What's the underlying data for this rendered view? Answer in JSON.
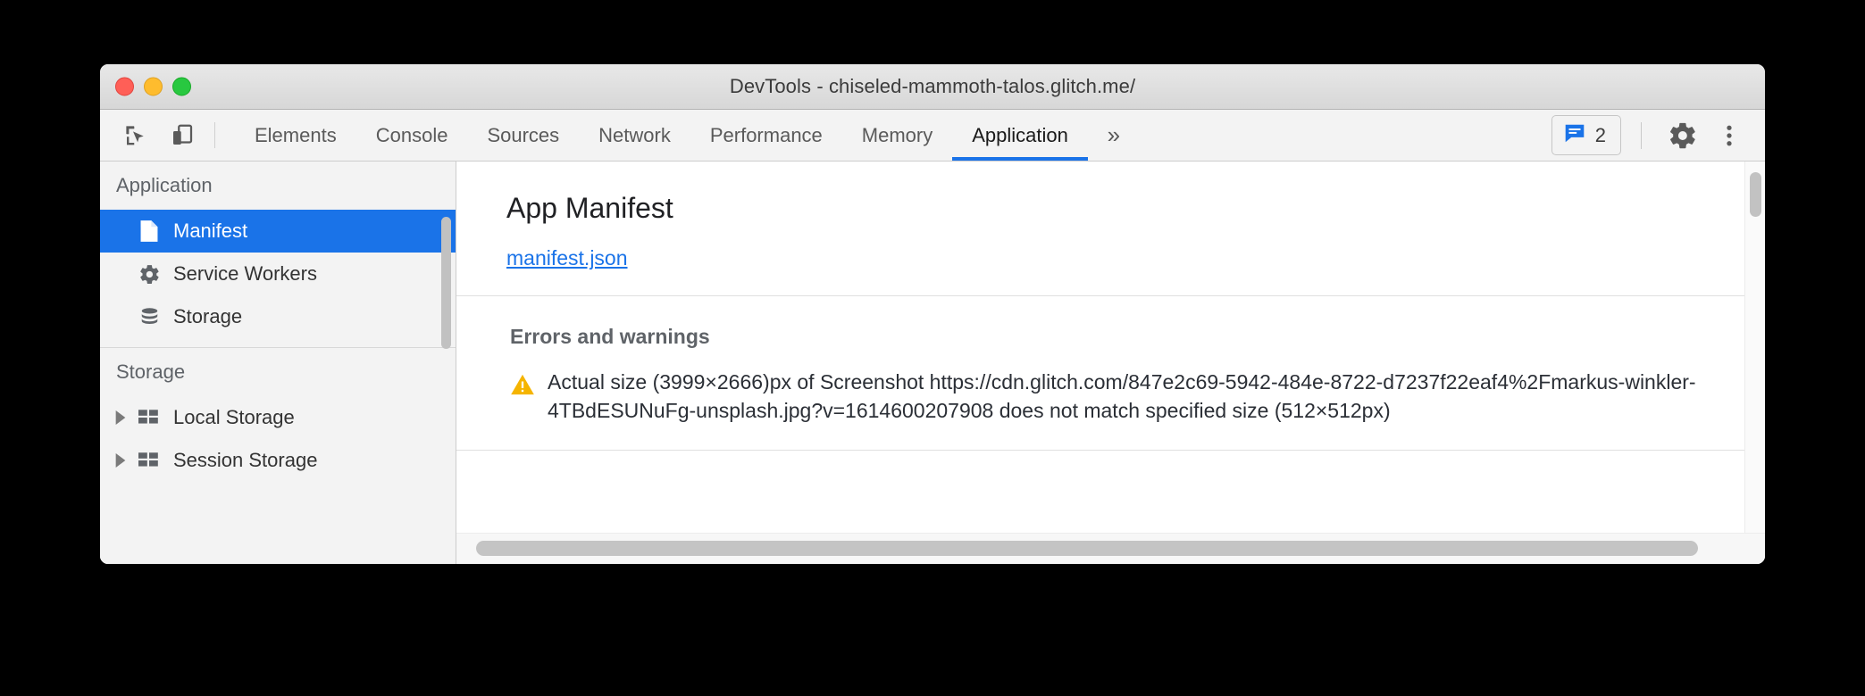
{
  "window": {
    "title": "DevTools - chiseled-mammoth-talos.glitch.me/",
    "traffic_lights": [
      "close",
      "minimize",
      "zoom"
    ]
  },
  "toolbar": {
    "inspect_icon": "inspect-cursor-icon",
    "device_icon": "device-toolbar-icon",
    "tabs": [
      {
        "label": "Elements",
        "active": false
      },
      {
        "label": "Console",
        "active": false
      },
      {
        "label": "Sources",
        "active": false
      },
      {
        "label": "Network",
        "active": false
      },
      {
        "label": "Performance",
        "active": false
      },
      {
        "label": "Memory",
        "active": false
      },
      {
        "label": "Application",
        "active": true
      }
    ],
    "overflow_label": "»",
    "messages": {
      "icon": "message-bubble-icon",
      "count": "2"
    },
    "settings_icon": "gear-icon",
    "more_icon": "more-vertical-icon",
    "active_tab_color": "#1a73e8"
  },
  "sidebar": {
    "sections": [
      {
        "title": "Application",
        "items": [
          {
            "label": "Manifest",
            "icon": "document-icon",
            "selected": true,
            "caret": false
          },
          {
            "label": "Service Workers",
            "icon": "gear-icon",
            "selected": false,
            "caret": false
          },
          {
            "label": "Storage",
            "icon": "database-icon",
            "selected": false,
            "caret": false
          }
        ]
      },
      {
        "title": "Storage",
        "items": [
          {
            "label": "Local Storage",
            "icon": "table-icon",
            "selected": false,
            "caret": true
          },
          {
            "label": "Session Storage",
            "icon": "table-icon",
            "selected": false,
            "caret": true
          }
        ]
      }
    ],
    "selected_bg": "#1a73e8"
  },
  "main": {
    "panel_title": "App Manifest",
    "manifest_link": "manifest.json",
    "errors_section_title": "Errors and warnings",
    "warning": {
      "icon": "warning-triangle-icon",
      "icon_color": "#f5b400",
      "text": "Actual size (3999×2666)px of Screenshot https://cdn.glitch.com/847e2c69-5942-484e-8722-d7237f22eaf4%2Fmarkus-winkler-4TBdESUNuFg-unsplash.jpg?v=1614600207908 does not match specified size (512×512px)"
    }
  }
}
